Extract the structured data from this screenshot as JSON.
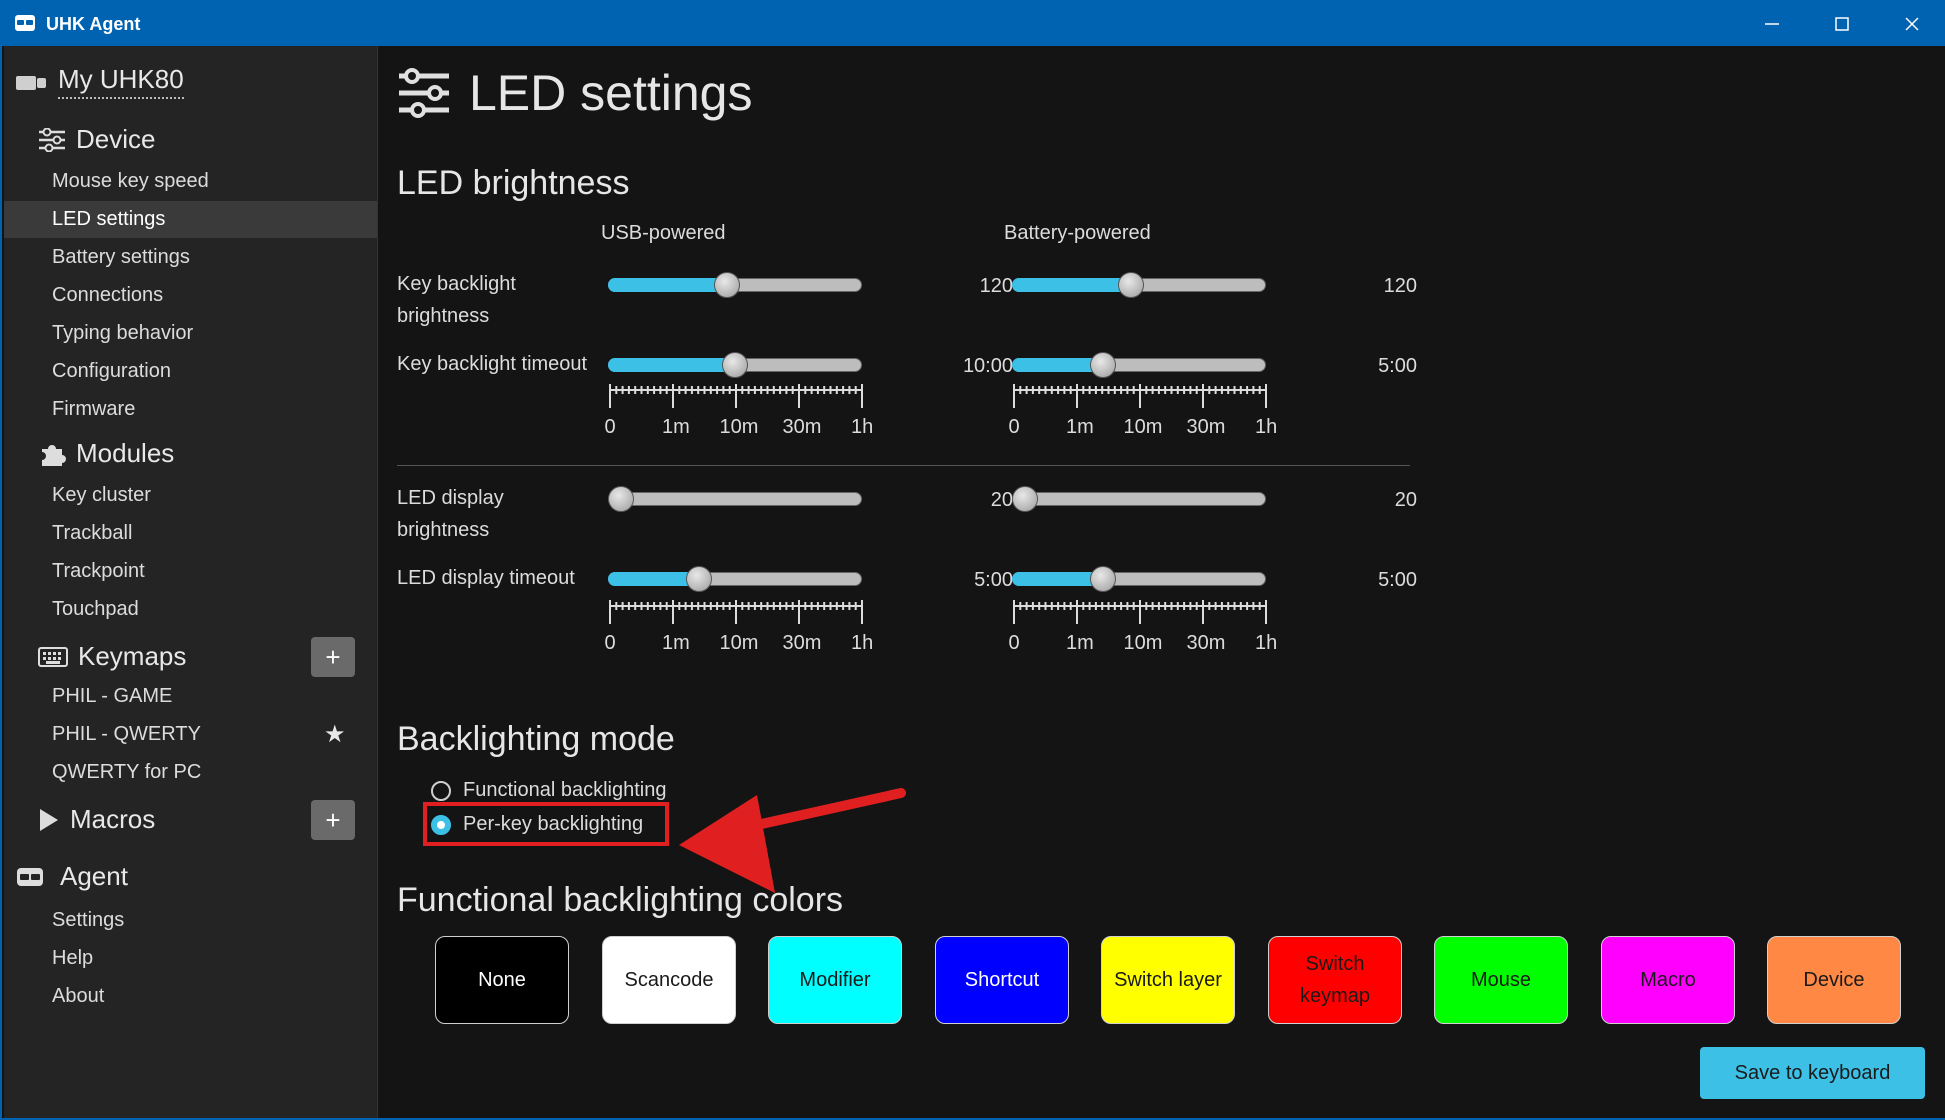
{
  "window": {
    "title": "UHK Agent"
  },
  "sidebar": {
    "device_name": "My UHK80",
    "sections": {
      "device": "Device",
      "modules": "Modules",
      "keymaps": "Keymaps",
      "macros": "Macros",
      "agent": "Agent"
    },
    "device_items": [
      "Mouse key speed",
      "LED settings",
      "Battery settings",
      "Connections",
      "Typing behavior",
      "Configuration",
      "Firmware"
    ],
    "module_items": [
      "Key cluster",
      "Trackball",
      "Trackpoint",
      "Touchpad"
    ],
    "keymap_items": [
      "PHIL - GAME",
      "PHIL - QWERTY",
      "QWERTY for PC"
    ],
    "agent_items": [
      "Settings",
      "Help",
      "About"
    ],
    "plus": "+",
    "star": "★"
  },
  "main": {
    "title": "LED settings",
    "brightness": {
      "heading": "LED brightness",
      "usb_label": "USB-powered",
      "battery_label": "Battery-powered",
      "rows": [
        {
          "label": "Key backlight brightness",
          "usb": {
            "value": "120",
            "level": 0.47
          },
          "battery": {
            "value": "120",
            "level": 0.47
          }
        },
        {
          "label": "Key backlight timeout",
          "usb": {
            "value": "10:00",
            "level": 0.5
          },
          "battery": {
            "value": "5:00",
            "level": 0.36
          }
        },
        {
          "label": "LED display brightness",
          "usb": {
            "value": "20",
            "level": 0.04
          },
          "battery": {
            "value": "20",
            "level": 0.04
          }
        },
        {
          "label": "LED display timeout",
          "usb": {
            "value": "5:00",
            "level": 0.36
          },
          "battery": {
            "value": "5:00",
            "level": 0.36
          }
        }
      ],
      "tick_labels": [
        "0",
        "1m",
        "10m",
        "30m",
        "1h"
      ]
    },
    "backlighting": {
      "heading": "Backlighting mode",
      "options": [
        "Functional backlighting",
        "Per-key backlighting"
      ],
      "selected": 1
    },
    "colors": {
      "heading": "Functional backlighting colors",
      "buttons": [
        {
          "label": "None",
          "bg": "#000000",
          "fg": "#ffffff"
        },
        {
          "label": "Scancode",
          "bg": "#ffffff",
          "fg": "#1a1a1a"
        },
        {
          "label": "Modifier",
          "bg": "#00ffff",
          "fg": "#1a1a1a"
        },
        {
          "label": "Shortcut",
          "bg": "#0000ff",
          "fg": "#ffffff"
        },
        {
          "label": "Switch layer",
          "bg": "#ffff00",
          "fg": "#1a1a1a"
        },
        {
          "label": "Switch keymap",
          "bg": "#ff0000",
          "fg": "#1a1a1a"
        },
        {
          "label": "Mouse",
          "bg": "#00ff00",
          "fg": "#1a1a1a"
        },
        {
          "label": "Macro",
          "bg": "#ff00ff",
          "fg": "#1a1a1a"
        },
        {
          "label": "Device",
          "bg": "#ff8844",
          "fg": "#1a1a1a"
        }
      ]
    },
    "save_label": "Save to keyboard"
  }
}
